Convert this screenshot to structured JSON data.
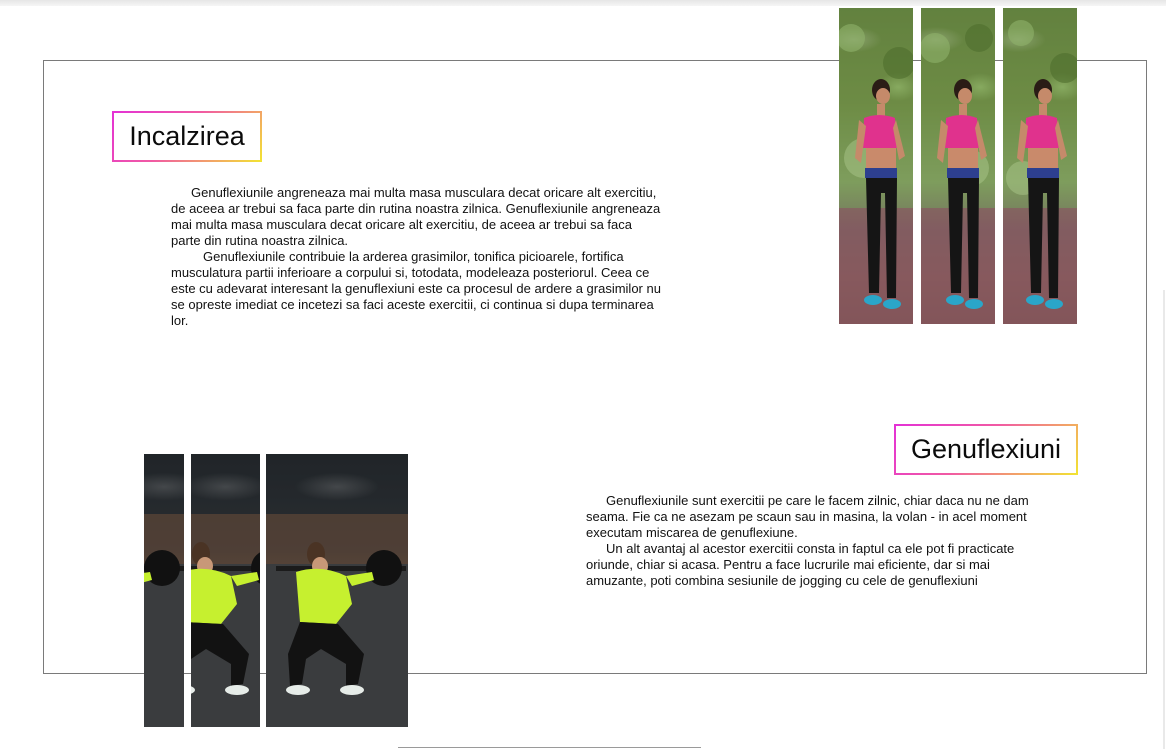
{
  "section_1": {
    "title": "Incalzirea",
    "paragraph_1": "Genuflexiunile angreneaza mai multa masa musculara decat oricare alt exercitiu, de aceea  ar trebui sa faca parte din rutina noastra zilnica. Genuflexiunile angreneaza mai multa masa musculara decat oricare alt exercitiu, de aceea ar trebui sa faca parte din rutina noastra zilnica.",
    "paragraph_2": "Genuflexiunile contribuie la arderea grasimilor, tonifica picioarele, fortifica musculatura partii inferioare a corpului si, totodata, modeleaza posteriorul. Ceea ce este cu adevarat interesant la genuflexiuni este ca procesul de ardere a grasimilor nu se opreste imediat ce incetezi sa faci aceste exercitii, ci continua si dupa terminarea lor."
  },
  "section_2": {
    "title": "Genuflexiuni",
    "paragraph_1": "Genuflexiunile sunt exercitii pe care le facem zilnic, chiar daca nu ne dam seama. Fie ca ne asezam pe scaun sau in masina, la volan - in acel moment executam miscarea de genuflexiune.",
    "paragraph_2": "Un alt avantaj al acestor exercitii consta in faptul ca ele pot fi practicate oriunde, chiar si acasa. Pentru a face lucrurile mai eficiente, dar si mai amuzante, poti combina sesiunile de jogging cu cele de genuflexiuni"
  },
  "images": {
    "runner": "woman-jogging-photo",
    "squat": "woman-barbell-squat-photo"
  },
  "colors": {
    "gradient_start": "#e331d6",
    "gradient_mid": "#f15aa3",
    "gradient_end": "#f2e531",
    "frame": "#7a7a7a"
  }
}
